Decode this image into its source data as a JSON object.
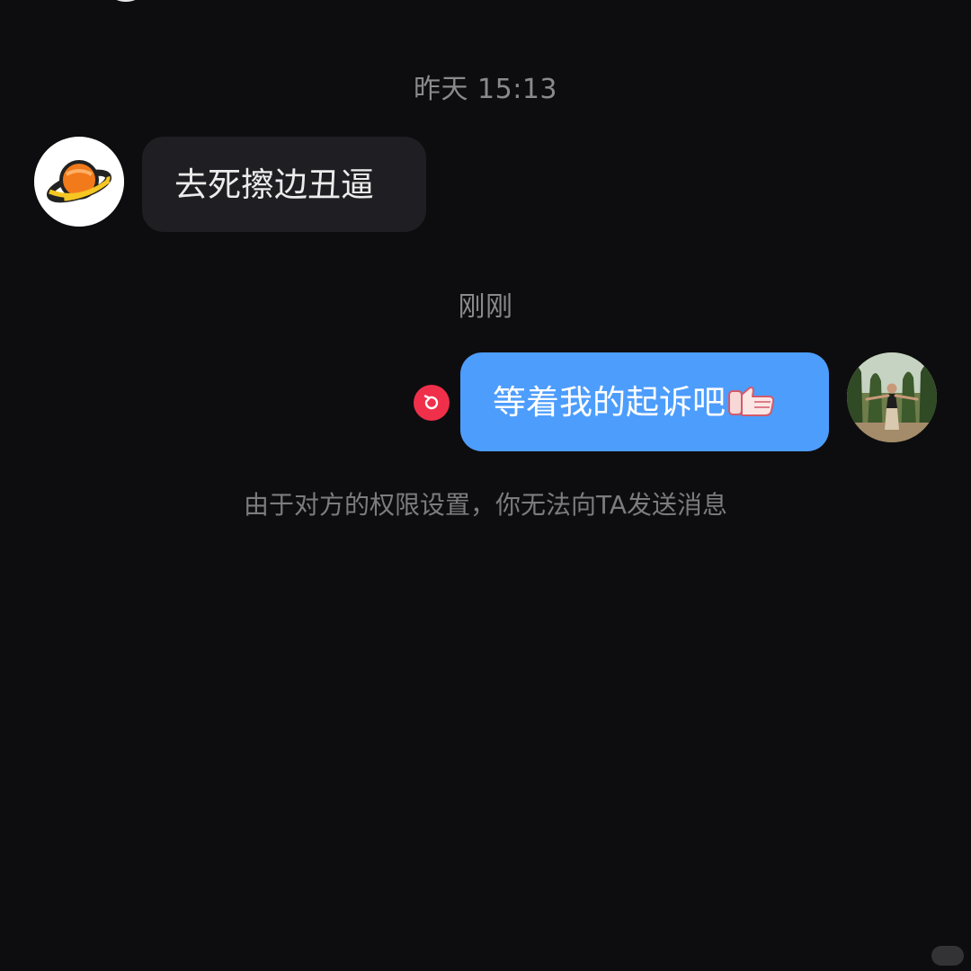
{
  "chat": {
    "timestamp_1": "昨天 15:13",
    "timestamp_2": "刚刚",
    "messages": [
      {
        "side": "left",
        "text": "去死擦边丑逼",
        "avatar_icon": "planet-icon"
      },
      {
        "side": "right",
        "text": "等着我的起诉吧",
        "emoji_icon": "thumbs-up-icon",
        "avatar_icon": "user-photo-avatar",
        "status_icon": "resend-icon"
      }
    ],
    "notice": "由于对方的权限设置，你无法向TA发送消息"
  },
  "colors": {
    "background": "#0d0d0f",
    "incoming_bubble": "#1f1f23",
    "outgoing_bubble": "#4d9dfd",
    "timestamp_text": "#8a8a8e",
    "resend_badge": "#f0304a"
  }
}
